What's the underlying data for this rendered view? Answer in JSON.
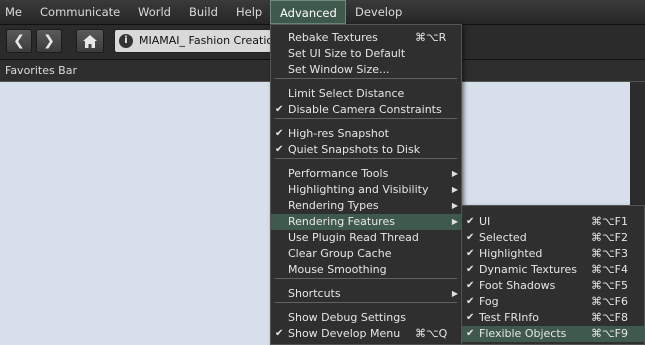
{
  "menubar": {
    "items": [
      "Me",
      "Communicate",
      "World",
      "Build",
      "Help",
      "Advanced",
      "Develop"
    ],
    "active": "Advanced"
  },
  "nav": {
    "back_icon": "arrow-left-icon",
    "forward_icon": "arrow-right-icon",
    "home_icon": "home-icon",
    "info_icon": "info-icon",
    "location": "MIAMAI_ Fashion Creatio"
  },
  "favorites": {
    "label": "Favorites Bar"
  },
  "advanced_menu": {
    "items": [
      {
        "label": "Rebake Textures",
        "shortcut": "⌘⌥R",
        "checked": false,
        "submenu": false
      },
      {
        "label": "Set UI Size to Default",
        "shortcut": "",
        "checked": false,
        "submenu": false
      },
      {
        "label": "Set Window Size...",
        "shortcut": "",
        "checked": false,
        "submenu": false
      },
      {
        "label": "Limit Select Distance",
        "shortcut": "",
        "checked": false,
        "submenu": false
      },
      {
        "label": "Disable Camera Constraints",
        "shortcut": "",
        "checked": true,
        "submenu": false
      },
      {
        "label": "High-res Snapshot",
        "shortcut": "",
        "checked": true,
        "submenu": false
      },
      {
        "label": "Quiet Snapshots to Disk",
        "shortcut": "",
        "checked": true,
        "submenu": false
      },
      {
        "label": "Performance Tools",
        "shortcut": "",
        "checked": false,
        "submenu": true
      },
      {
        "label": "Highlighting and Visibility",
        "shortcut": "",
        "checked": false,
        "submenu": true
      },
      {
        "label": "Rendering Types",
        "shortcut": "",
        "checked": false,
        "submenu": true
      },
      {
        "label": "Rendering Features",
        "shortcut": "",
        "checked": false,
        "submenu": true,
        "highlighted": true
      },
      {
        "label": "Use Plugin Read Thread",
        "shortcut": "",
        "checked": false,
        "submenu": false
      },
      {
        "label": "Clear Group Cache",
        "shortcut": "",
        "checked": false,
        "submenu": false
      },
      {
        "label": "Mouse Smoothing",
        "shortcut": "",
        "checked": false,
        "submenu": false
      },
      {
        "label": "Shortcuts",
        "shortcut": "",
        "checked": false,
        "submenu": true
      },
      {
        "label": "Show Debug Settings",
        "shortcut": "",
        "checked": false,
        "submenu": false
      },
      {
        "label": "Show Develop Menu",
        "shortcut": "⌘⌥Q",
        "checked": true,
        "submenu": false
      }
    ],
    "check_mark": "✔",
    "submenu_arrow": "▶"
  },
  "rendering_features_menu": {
    "items": [
      {
        "label": "UI",
        "shortcut": "⌘⌥F1",
        "checked": true
      },
      {
        "label": "Selected",
        "shortcut": "⌘⌥F2",
        "checked": true
      },
      {
        "label": "Highlighted",
        "shortcut": "⌘⌥F3",
        "checked": true
      },
      {
        "label": "Dynamic Textures",
        "shortcut": "⌘⌥F4",
        "checked": true
      },
      {
        "label": "Foot Shadows",
        "shortcut": "⌘⌥F5",
        "checked": true
      },
      {
        "label": "Fog",
        "shortcut": "⌘⌥F6",
        "checked": true
      },
      {
        "label": "Test FRInfo",
        "shortcut": "⌘⌥F8",
        "checked": true
      },
      {
        "label": "Flexible Objects",
        "shortcut": "⌘⌥F9",
        "checked": true,
        "highlighted": true
      }
    ]
  },
  "colors": {
    "menu_bg": "#2f2f2f",
    "highlight": "#3f5a4d",
    "content_bg": "#d6dfea"
  }
}
